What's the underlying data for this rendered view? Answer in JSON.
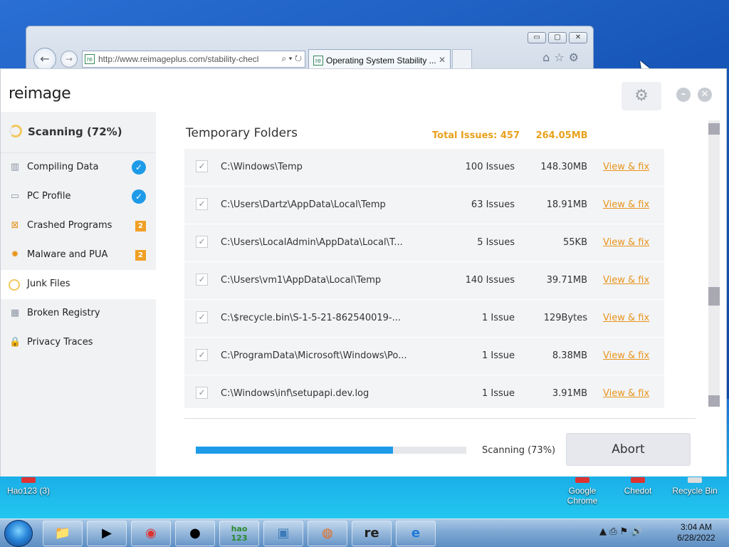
{
  "browser": {
    "address_url": "http://www.reimageplus.com/stability-checl",
    "address_tools": "⌕ ▾ ↻",
    "tab_title": "Operating System Stability ...",
    "tab_close": "✕",
    "site_icon": "re",
    "window_controls": [
      "▭",
      "▢",
      "✕"
    ],
    "tool_icons": [
      "home-icon",
      "star-icon",
      "gear-icon"
    ]
  },
  "app": {
    "logo": "reimage",
    "header_buttons": {
      "minimize": "–",
      "close": "✕"
    },
    "sidebar": {
      "status": "Scanning (72%)",
      "items": [
        {
          "label": "Compiling Data",
          "icon": "chart-icon",
          "state": "done"
        },
        {
          "label": "PC Profile",
          "icon": "monitor-icon",
          "state": "done"
        },
        {
          "label": "Crashed Programs",
          "icon": "crashed-icon",
          "badge": "2"
        },
        {
          "label": "Malware and PUA",
          "icon": "bug-icon",
          "badge": "2"
        },
        {
          "label": "Junk Files",
          "icon": "spinner-ring-icon",
          "state": "active"
        },
        {
          "label": "Broken Registry",
          "icon": "registry-icon"
        },
        {
          "label": "Privacy Traces",
          "icon": "lock-icon"
        }
      ]
    },
    "main": {
      "section_title": "Temporary Folders",
      "total_issues": "Total Issues: 457",
      "total_size": "264.05MB",
      "link_label": "View & fix",
      "rows": [
        {
          "path": "C:\\Windows\\Temp",
          "issues": "100 Issues",
          "size": "148.30MB"
        },
        {
          "path": "C:\\Users\\Dartz\\AppData\\Local\\Temp",
          "issues": "63 Issues",
          "size": "18.91MB"
        },
        {
          "path": "C:\\Users\\LocalAdmin\\AppData\\Local\\T...",
          "issues": "5 Issues",
          "size": "55KB"
        },
        {
          "path": "C:\\Users\\vm1\\AppData\\Local\\Temp",
          "issues": "140 Issues",
          "size": "39.71MB"
        },
        {
          "path": "C:\\$recycle.bin\\S-1-5-21-862540019-...",
          "issues": "1 Issue",
          "size": "129Bytes"
        },
        {
          "path": "C:\\ProgramData\\Microsoft\\Windows\\Po...",
          "issues": "1 Issue",
          "size": "8.38MB"
        },
        {
          "path": "C:\\Windows\\inf\\setupapi.dev.log",
          "issues": "1 Issue",
          "size": "3.91MB"
        }
      ],
      "progress_value": 0.73,
      "progress_label": "Scanning (73%)",
      "abort_label": "Abort"
    }
  },
  "desktop": {
    "icons": [
      {
        "label": "Hao123 (3)"
      },
      {
        "label": "Google Chrome"
      },
      {
        "label": "Chedot"
      },
      {
        "label": "Recycle Bin"
      }
    ]
  },
  "taskbar": {
    "apps": [
      "explorer-icon",
      "media-icon",
      "chrome-icon",
      "bird-icon",
      "hao123-icon",
      "cubes-icon",
      "firefox-icon",
      "reimage-icon",
      "ie-icon"
    ],
    "hao123_text": "hao\n123",
    "reimage_text": "re",
    "time": "3:04 AM",
    "date": "6/28/2022",
    "tray_glyphs": "▲ ⎙ ⚑ 🔊"
  },
  "colors": {
    "accent": "#1e9be8",
    "warning": "#e8951c",
    "badge": "#f0a024"
  }
}
